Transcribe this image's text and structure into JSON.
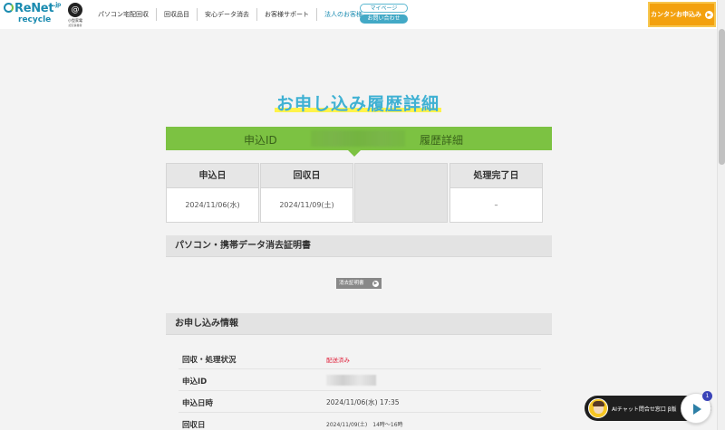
{
  "header": {
    "logo_main": "ReNet",
    "logo_suffix": ".jp",
    "logo_sub": "recycle",
    "badge_symbol": "@",
    "badge_line1": "小型家電",
    "badge_line2": "認定事業者",
    "nav": [
      "パソコン宅配回収",
      "回収品目",
      "安心データ消去",
      "お客様サポート",
      "法人のお客様"
    ],
    "mypage_label": "マイページ",
    "contact_label": "お問い合わせ",
    "cta_label": "カンタンお申込み",
    "cta_arrow": "▶"
  },
  "page": {
    "title": "お申し込み履歴詳細",
    "id_label": "申込ID",
    "id_suffix": "履歴詳細"
  },
  "cards": [
    {
      "label": "申込日",
      "value": "2024/11/06(水)"
    },
    {
      "label": "回収日",
      "value": "2024/11/09(土)"
    },
    {
      "label": "",
      "value": ""
    },
    {
      "label": "処理完了日",
      "value": "–"
    }
  ],
  "certificate": {
    "heading": "パソコン・携帯データ消去証明書",
    "button_label": "消去証明書",
    "button_arrow": "▶"
  },
  "application": {
    "heading": "お申し込み情報",
    "rows": [
      {
        "label": "回収・処理状況",
        "value": "配送済み"
      },
      {
        "label": "申込ID",
        "value": ""
      },
      {
        "label": "申込日時",
        "value": "2024/11/06(水) 17:35"
      },
      {
        "label": "回収日",
        "value": "2024/11/09(土)　14時～16時"
      }
    ]
  },
  "chat": {
    "label": "AIチャット問合せ窓口 β版",
    "badge": "1"
  },
  "colors": {
    "brand": "#1a8bb0",
    "green": "#7cc242",
    "title": "#3fb1d3",
    "highlight": "#fff34a",
    "cta": "#f3a10e",
    "status_red": "#e0203a"
  }
}
